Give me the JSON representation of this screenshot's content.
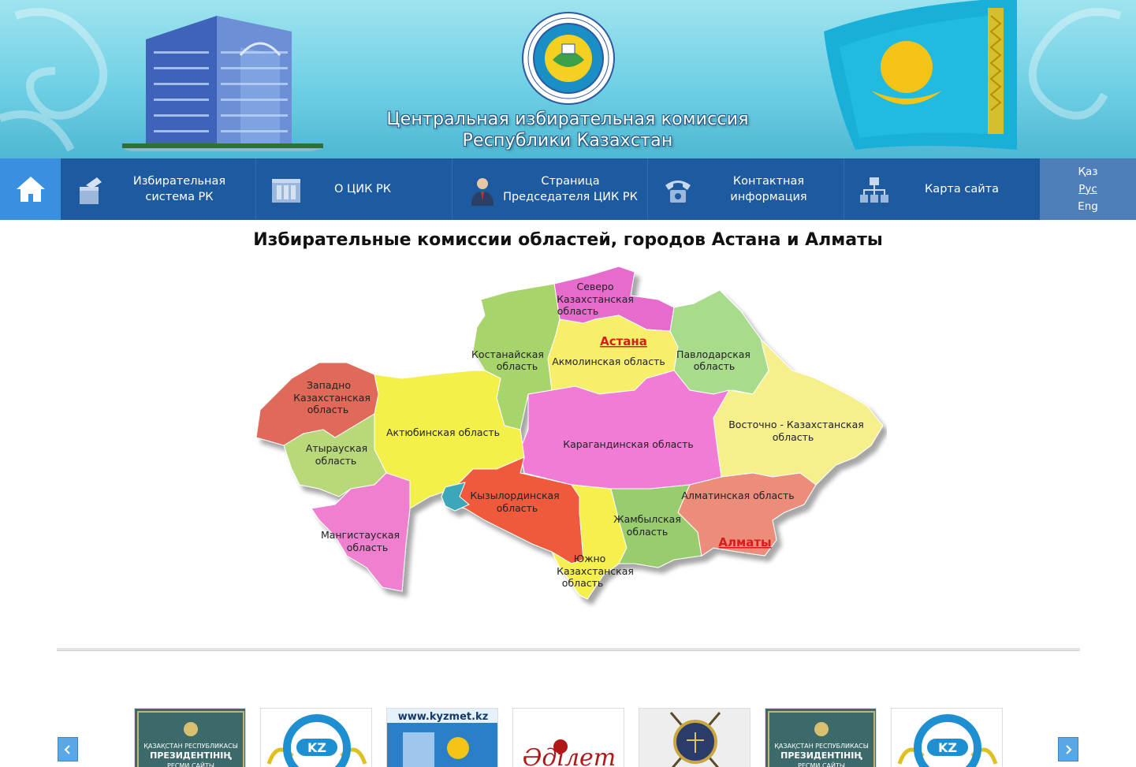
{
  "header": {
    "title_line1": "Центральная избирательная комиссия",
    "title_line2": "Республики Казахстан",
    "seal_icon": "cec-seal-icon",
    "building_icon": "cec-building-icon",
    "flag_icon": "kazakhstan-flag-icon"
  },
  "nav": {
    "home_icon": "home-icon",
    "items": [
      {
        "label": "Избирательная система РК",
        "icon": "ballot-box-icon"
      },
      {
        "label": "О ЦИК РК",
        "icon": "building-icon"
      },
      {
        "label": "Страница Председателя ЦИК РК",
        "icon": "person-icon"
      },
      {
        "label": "Контактная информация",
        "icon": "phone-icon"
      },
      {
        "label": "Карта сайта",
        "icon": "sitemap-icon"
      }
    ],
    "languages": {
      "kaz": "Қаз",
      "rus": "Рус",
      "eng": "Eng",
      "active": "Рус"
    }
  },
  "main": {
    "title": "Избирательные комиссии областей, городов Астана и Алматы",
    "regions": {
      "north_kaz": [
        "Северо",
        "Казахстанская",
        "область"
      ],
      "kostanay": [
        "Костанайская",
        "область"
      ],
      "pavlodar": [
        "Павлодарская",
        "область"
      ],
      "akmola": "Акмолинская область",
      "astana": "Астана",
      "west_kaz": [
        "Западно",
        "Казахстанская",
        "область"
      ],
      "aktobe": "Актюбинская область",
      "karaganda": "Карагандинская область",
      "east_kaz": [
        "Восточно - Казахстанская",
        "область"
      ],
      "atyrau": [
        "Атырауская",
        "область"
      ],
      "kyzylorda": [
        "Кызылординская",
        "область"
      ],
      "almaty_region": "Алматинская область",
      "mangistau": [
        "Мангистауская",
        "область"
      ],
      "zhambyl": [
        "Жамбылская",
        "область"
      ],
      "almaty": "Алматы",
      "south_kaz": [
        "Южно",
        "Казахстанская",
        "область"
      ]
    },
    "region_colors": {
      "north_kaz": "#e66ccc",
      "kostanay": "#a8d46c",
      "pavlodar": "#a8dc8c",
      "akmola": "#f7ef6a",
      "west_kaz": "#e06a5a",
      "aktobe": "#f2f04a",
      "karaganda": "#f07cd6",
      "east_kaz": "#f5f08c",
      "atyrau": "#b8d87a",
      "kyzylorda": "#ef5a3e",
      "almaty_region": "#ec8d7c",
      "mangistau": "#ee80cf",
      "zhambyl": "#98cc6c",
      "south_kaz": "#f5f04e",
      "aral": "#3aa7b9"
    }
  },
  "carousel": {
    "prev_icon": "chevron-left-icon",
    "next_icon": "chevron-right-icon",
    "items": [
      {
        "name": "president-site-banner",
        "line1": "ҚАЗАҚСТАН РЕСПУБЛИКАСЫ",
        "line2": "ПРЕЗИДЕНТІНІҢ",
        "line3": "РЕСМИ САЙТЫ"
      },
      {
        "name": "egov-banner",
        "text": "KZ"
      },
      {
        "name": "kyzmet-banner",
        "text": "www.kyzmet.kz"
      },
      {
        "name": "adilet-banner",
        "text": "Әділет"
      },
      {
        "name": "justice-emblem-banner",
        "text": ""
      },
      {
        "name": "president-site-banner-2",
        "line1": "ҚАЗАҚСТАН РЕСПУБЛИКАСЫ",
        "line2": "ПРЕЗИДЕНТІНІҢ",
        "line3": "РЕСМИ САЙТЫ"
      },
      {
        "name": "egov-banner-2",
        "text": "KZ"
      }
    ]
  }
}
